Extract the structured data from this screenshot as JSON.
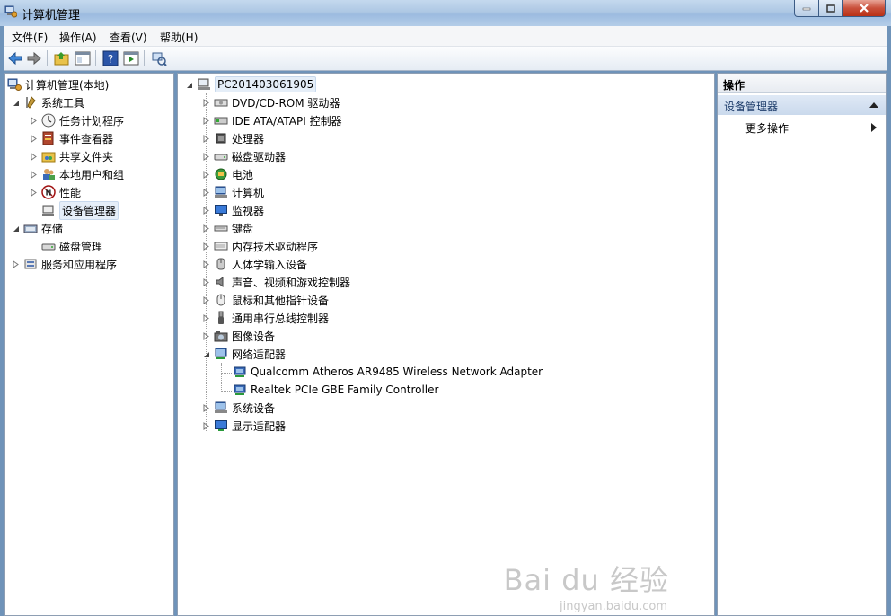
{
  "window": {
    "title": "计算机管理"
  },
  "menu": {
    "items": [
      {
        "label": "文件(F)"
      },
      {
        "label": "操作(A)"
      },
      {
        "label": "查看(V)"
      },
      {
        "label": "帮助(H)"
      }
    ]
  },
  "left_tree": {
    "root": "计算机管理(本地)",
    "system_tools": "系统工具",
    "task_scheduler": "任务计划程序",
    "event_viewer": "事件查看器",
    "shared_folders": "共享文件夹",
    "local_users": "本地用户和组",
    "performance": "性能",
    "device_manager": "设备管理器",
    "storage": "存储",
    "disk_management": "磁盘管理",
    "services": "服务和应用程序"
  },
  "device_tree": {
    "root": "PC201403061905",
    "categories": [
      "DVD/CD-ROM 驱动器",
      "IDE ATA/ATAPI 控制器",
      "处理器",
      "磁盘驱动器",
      "电池",
      "计算机",
      "监视器",
      "键盘",
      "内存技术驱动程序",
      "人体学输入设备",
      "声音、视频和游戏控制器",
      "鼠标和其他指针设备",
      "通用串行总线控制器",
      "图像设备",
      "网络适配器"
    ],
    "network_adapters": [
      "Qualcomm Atheros AR9485 Wireless Network Adapter",
      "Realtek PCIe GBE Family Controller"
    ],
    "after": [
      "系统设备",
      "显示适配器"
    ]
  },
  "actions": {
    "header": "操作",
    "section": "设备管理器",
    "more": "更多操作"
  },
  "watermark": {
    "main": "Bai du 经验",
    "sub": "jingyan.baidu.com"
  },
  "colors": {
    "title_bar": "#aec8e4",
    "selection": "#e5eef8",
    "action_section": "#cad9ec"
  }
}
